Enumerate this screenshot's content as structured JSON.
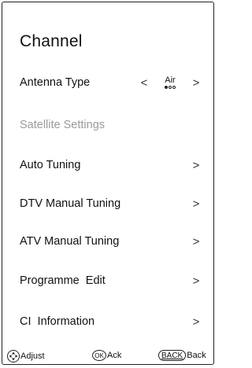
{
  "menu": {
    "title": "Channel",
    "antenna": {
      "label": "Antenna Type",
      "value": "Air",
      "left_icon": "chevron-left-icon",
      "right_icon": "chevron-right-icon",
      "left_glyph": "<",
      "right_glyph": ">"
    },
    "items": [
      {
        "label": "Satellite Settings",
        "enabled": false
      },
      {
        "label": "Auto Tuning",
        "enabled": true,
        "arrow": ">"
      },
      {
        "label": "DTV Manual Tuning",
        "enabled": true,
        "arrow": ">"
      },
      {
        "label": "ATV Manual Tuning",
        "enabled": true,
        "arrow": ">"
      },
      {
        "label": "Programme  Edit",
        "enabled": true,
        "arrow": ">"
      },
      {
        "label": "CI  Information",
        "enabled": true,
        "arrow": ">"
      }
    ]
  },
  "footer": {
    "adjust_label": "Adjust",
    "adjust_icon": "dpad-icon",
    "ok_glyph": "OK",
    "ok_label": "Ack",
    "back_glyph": "BACK",
    "back_label": "Back"
  },
  "colors": {
    "text": "#111111",
    "disabled_text": "#9a9a9a",
    "border": "#222222",
    "background": "#ffffff"
  }
}
